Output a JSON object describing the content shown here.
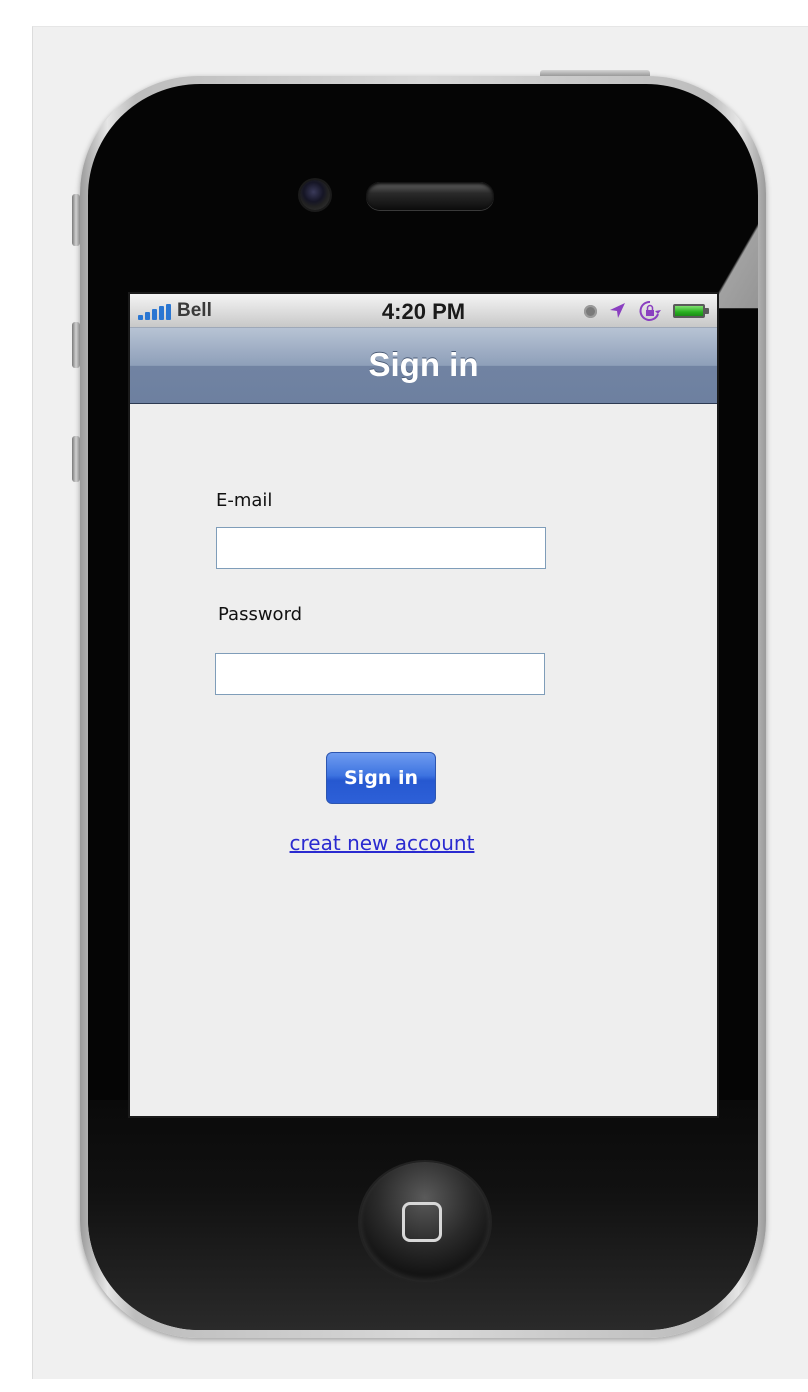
{
  "status_bar": {
    "carrier": "Bell",
    "time": "4:20 PM",
    "icons": [
      "signal-bars-icon",
      "clock-icon",
      "location-arrow-icon",
      "orientation-lock-icon",
      "battery-icon"
    ]
  },
  "nav_bar": {
    "title": "Sign in"
  },
  "form": {
    "email_label": "E-mail",
    "email_value": "",
    "password_label": "Password",
    "password_value": "",
    "submit_label": "Sign in",
    "create_account_link": "creat new account"
  },
  "colors": {
    "nav_bar": "#7183a2",
    "button": "#3d73e0",
    "link": "#2a2ad0",
    "screen_bg": "#eeeeee",
    "battery": "#28b020"
  }
}
